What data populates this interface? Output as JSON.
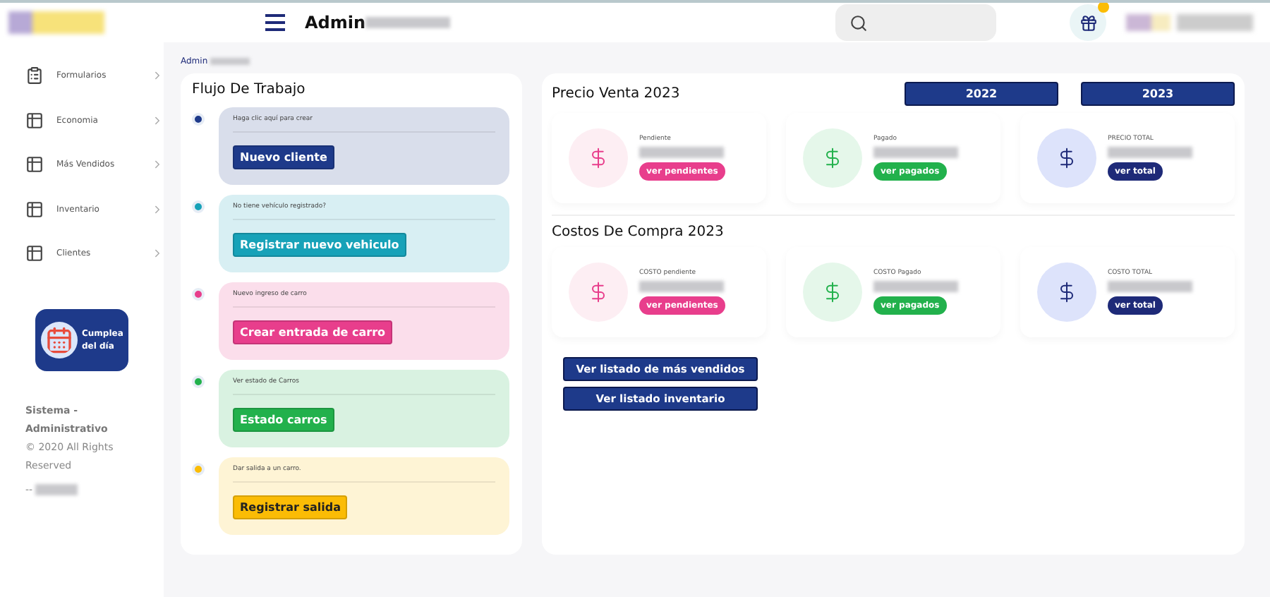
{
  "header": {
    "title": "Admin"
  },
  "sidebar": {
    "items": [
      {
        "label": "Formularios"
      },
      {
        "label": "Economia"
      },
      {
        "label": "Más Vendidos"
      },
      {
        "label": "Inventario"
      },
      {
        "label": "Clientes"
      }
    ],
    "promo": {
      "line_1": "Cumplea",
      "line_2": "del día"
    },
    "footer": {
      "title": "Sistema - Administrativo",
      "copyright": "© 2020 All Rights Reserved",
      "signature": "--"
    }
  },
  "breadcrumb": "Admin",
  "workflow": {
    "title": "Flujo De Trabajo",
    "steps": [
      {
        "prompt": "Haga clic aquí para crear",
        "button": "Nuevo cliente",
        "color": "#1e3a8a"
      },
      {
        "prompt": "No tiene vehículo registrado?",
        "button": "Registrar nuevo vehiculo",
        "color": "#17a2b8"
      },
      {
        "prompt": "Nuevo ingreso de carro",
        "button": "Crear entrada de carro",
        "color": "#e83e8c"
      },
      {
        "prompt": "Ver estado de Carros",
        "button": "Estado carros",
        "color": "#22b14c"
      },
      {
        "prompt": "Dar salida a un carro.",
        "button": "Registrar salida",
        "color": "#fbbc05"
      }
    ]
  },
  "sales": {
    "title": "Precio Venta 2023",
    "years": [
      "2022",
      "2023"
    ],
    "cards": [
      {
        "kind": "pending",
        "label": "Pendiente",
        "button": "ver pendientes"
      },
      {
        "kind": "paid",
        "label": "Pagado",
        "button": "ver pagados"
      },
      {
        "kind": "total",
        "label": "PRECIO TOTAL",
        "button": "ver total"
      }
    ]
  },
  "costs": {
    "title": "Costos De Compra 2023",
    "cards": [
      {
        "kind": "pending",
        "label": "COSTO pendiente",
        "button": "ver pendientes"
      },
      {
        "kind": "paid",
        "label": "COSTO Pagado",
        "button": "ver pagados"
      },
      {
        "kind": "total",
        "label": "COSTO TOTAL",
        "button": "ver total"
      }
    ]
  },
  "links": [
    "Ver listado de más vendidos",
    "Ver listado inventario"
  ]
}
